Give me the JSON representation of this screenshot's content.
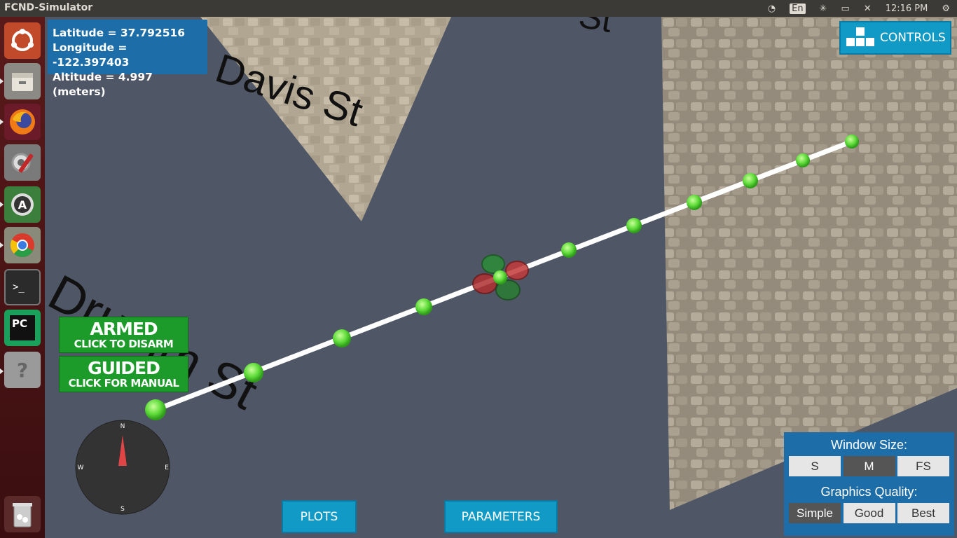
{
  "window": {
    "title": "FCND-Simulator"
  },
  "tray": {
    "language": "En",
    "clock": "12:16 PM"
  },
  "launcher": {
    "items": [
      {
        "name": "ubuntu-dash-icon"
      },
      {
        "name": "files-icon"
      },
      {
        "name": "firefox-icon"
      },
      {
        "name": "system-settings-icon"
      },
      {
        "name": "software-updater-icon"
      },
      {
        "name": "chrome-icon"
      },
      {
        "name": "terminal-icon"
      },
      {
        "name": "pycharm-icon",
        "label": "PC"
      },
      {
        "name": "help-icon",
        "label": "?"
      },
      {
        "name": "trash-icon"
      }
    ]
  },
  "telemetry": {
    "latitude": "Latitude = 37.792516",
    "longitude": "Longitude = -122.397403",
    "altitude": "Altitude = 4.997 (meters)"
  },
  "controls": {
    "label": "CONTROLS"
  },
  "armed": {
    "title": "ARMED",
    "subtitle": "CLICK TO DISARM"
  },
  "guided": {
    "title": "GUIDED",
    "subtitle": "CLICK FOR MANUAL"
  },
  "compass": {
    "north": "N",
    "south": "S",
    "east": "E",
    "west": "W"
  },
  "street_labels": {
    "davis": "Davis St",
    "drumm": "Drumm St",
    "top": "St"
  },
  "bottom": {
    "plots": "PLOTS",
    "parameters": "PARAMETERS"
  },
  "window_panel": {
    "size_header": "Window Size:",
    "sizes": [
      "S",
      "M",
      "FS"
    ],
    "selected_size": "M",
    "quality_header": "Graphics Quality:",
    "qualities": [
      "Simple",
      "Good",
      "Best"
    ],
    "selected_quality": "Simple"
  },
  "colors": {
    "accent": "#129ac6",
    "panel": "#1d6ea8",
    "armed_green": "#1c9a2a",
    "waypoint": "#6ee84a"
  }
}
